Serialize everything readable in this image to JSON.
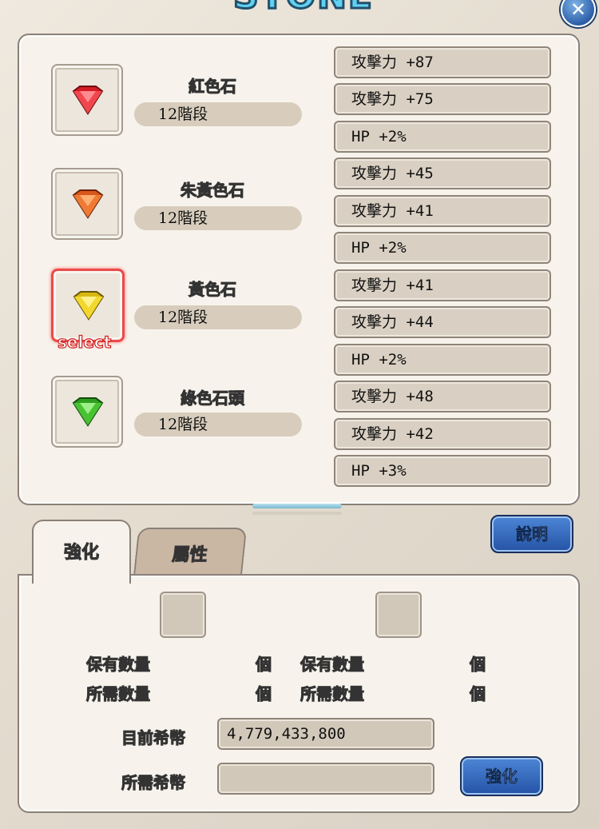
{
  "window": {
    "title": "STONE",
    "close_label": "✕"
  },
  "stones": [
    {
      "name": "紅色石",
      "level": "12階段",
      "color": "#e0202a",
      "selected": false
    },
    {
      "name": "朱黃色石",
      "level": "12階段",
      "color": "#ee6a1e",
      "selected": false
    },
    {
      "name": "黃色石",
      "level": "12階段",
      "color": "#f2d21a",
      "selected": true
    },
    {
      "name": "綠色石頭",
      "level": "12階段",
      "color": "#3fb92a",
      "selected": false
    }
  ],
  "select_label": "select",
  "stats": [
    "攻擊力 +87",
    "攻擊力 +75",
    "HP +2%",
    "攻擊力 +45",
    "攻擊力 +41",
    "HP +2%",
    "攻擊力 +41",
    "攻擊力 +44",
    "HP +2%",
    "攻擊力 +48",
    "攻擊力 +42",
    "HP +3%"
  ],
  "tabs": {
    "enhance": "強化",
    "attribute": "屬性"
  },
  "help_button": "說明",
  "materials": {
    "owned_label": "保有數量",
    "required_label": "所需數量",
    "unit": "個"
  },
  "currency": {
    "current_label": "目前希幣",
    "current_value": "4,779,433,800",
    "required_label": "所需希幣",
    "required_value": ""
  },
  "enhance_button": "強化"
}
